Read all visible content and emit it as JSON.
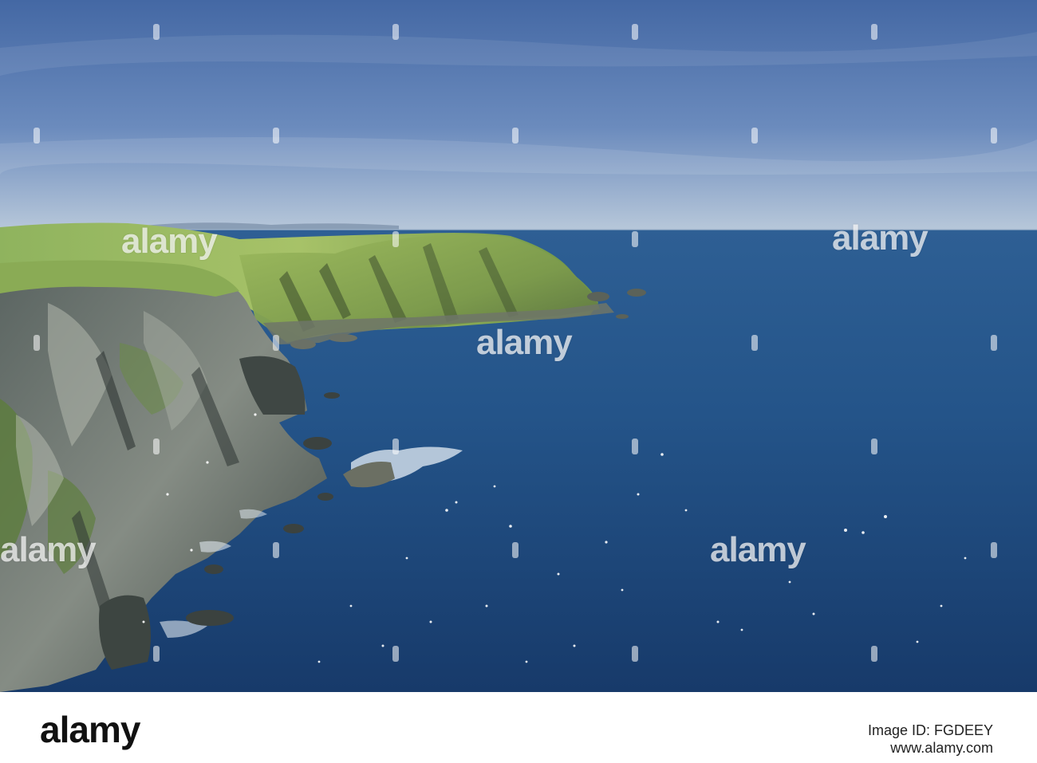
{
  "photo": {
    "scene": "sea-cliffs",
    "sky_color": "#4f6fa6",
    "sea_color": "#1f477a",
    "grass_color": "#7fa852"
  },
  "watermark": {
    "text": "alamy"
  },
  "footer": {
    "logo": "alamy",
    "image_id": "Image ID: FGDEEY",
    "url": "www.alamy.com"
  }
}
